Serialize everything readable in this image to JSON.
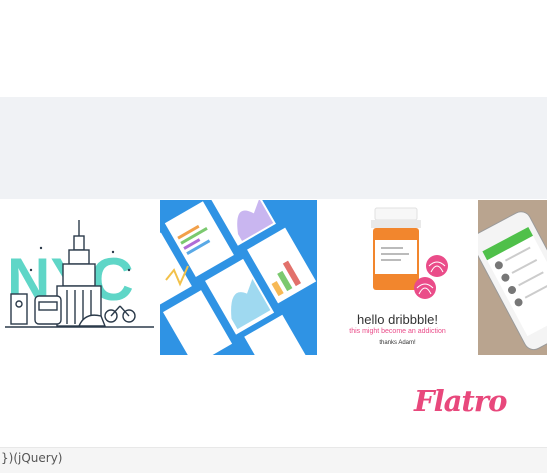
{
  "shots": [
    {
      "name": "NYC illustration",
      "text": "NYC"
    },
    {
      "name": "Dashboard charts mockups"
    },
    {
      "name": "Hello dribbble pill bottle",
      "title": "hello dribbble!",
      "subtitle": "this might become an addiction",
      "thanks": "thanks Adam!"
    },
    {
      "name": "Phone app mockup"
    }
  ],
  "brand": {
    "logo_text": "Flatro",
    "color": "#e8487c"
  },
  "console": {
    "code": "})(jQuery)"
  },
  "colors": {
    "band": "#f0f2f5",
    "nyc_teal": "#5fd6c7",
    "blue": "#2f93e4",
    "orange": "#f2862d"
  }
}
